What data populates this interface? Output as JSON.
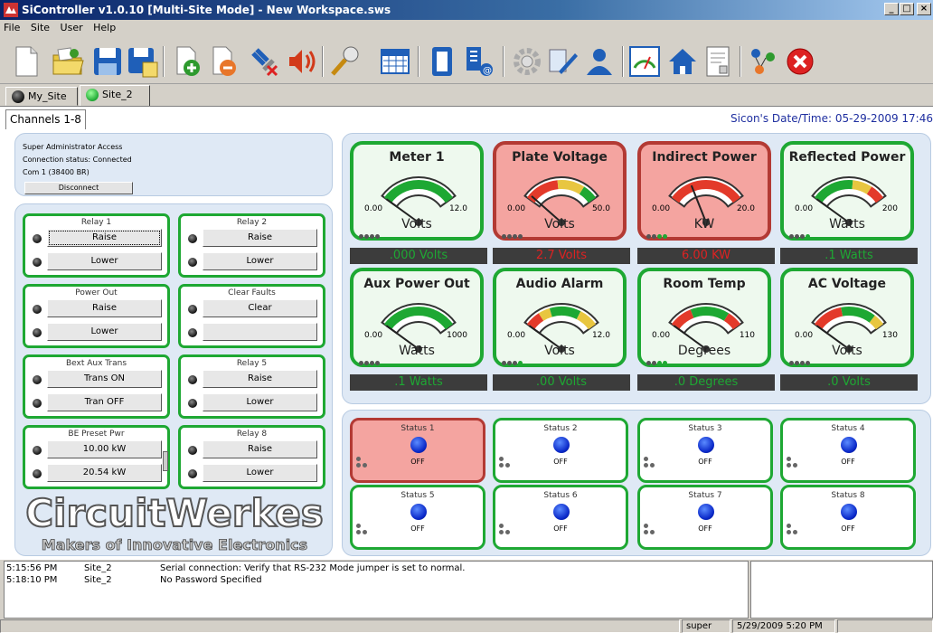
{
  "window": {
    "title": "SiController v1.0.10 [Multi-Site Mode] - New Workspace.sws",
    "controls": [
      "_",
      "□",
      "×"
    ]
  },
  "menu": [
    "File",
    "Site",
    "User",
    "Help"
  ],
  "toolbar_icons": [
    "new-file-icon",
    "open-folder-icon",
    "save-icon",
    "save-as-icon",
    "add-site-icon",
    "remove-site-icon",
    "disconnect-icon",
    "audio-icon",
    "microphone-icon",
    "calendar-icon",
    "panel-icon",
    "network-icon",
    "settings-icon",
    "edit-icon",
    "user-icon",
    "meter-icon",
    "home-icon",
    "report-icon",
    "users-network-icon",
    "exit-icon"
  ],
  "site_tabs": [
    {
      "label": "My_Site",
      "status": "dark"
    },
    {
      "label": "Site_2",
      "status": "green"
    }
  ],
  "channel_tab": "Channels 1-8",
  "sicon_datetime": "Sicon's Date/Time: 05-29-2009 17:46",
  "access": {
    "level": "Super Administrator Access",
    "connection": "Connection status: Connected",
    "port": "Com 1 (38400 BR)",
    "disconnect_label": "Disconnect"
  },
  "relays": [
    {
      "title": "Relay 1",
      "buttons": [
        "Raise",
        "Lower"
      ]
    },
    {
      "title": "Relay 2",
      "buttons": [
        "Raise",
        "Lower"
      ]
    },
    {
      "title": "Power Out",
      "buttons": [
        "Raise",
        "Lower"
      ]
    },
    {
      "title": "Clear Faults",
      "buttons": [
        "Clear",
        ""
      ]
    },
    {
      "title": "Bext Aux Trans",
      "buttons": [
        "Trans ON",
        "Tran OFF"
      ]
    },
    {
      "title": "Relay 5",
      "buttons": [
        "Raise",
        "Lower"
      ]
    },
    {
      "title": "BE Preset Pwr",
      "buttons": [
        "10.00 kW",
        "20.54 kW"
      ]
    },
    {
      "title": "Relay 8",
      "buttons": [
        "Raise",
        "Lower"
      ]
    }
  ],
  "brand": {
    "name": "CircuitWerkes",
    "tagline": "Makers of Innovative Electronics"
  },
  "meters": [
    {
      "title": "Meter 1",
      "unit": "Volts",
      "min": "0.00",
      "max": "12.0",
      "reading": ".000 Volts",
      "alarm": false,
      "needle": 0.0,
      "dots": [
        "d",
        "d",
        "d",
        "d"
      ]
    },
    {
      "title": "Plate Voltage",
      "unit": "Volts",
      "min": "0.00",
      "max": "50.0",
      "reading": "2.7 Volts",
      "alarm": true,
      "needle": 0.05,
      "dots": [
        "d",
        "d",
        "d",
        "d"
      ]
    },
    {
      "title": "Indirect Power",
      "unit": "KW",
      "min": "0.00",
      "max": "20.0",
      "reading": "6.00 KW",
      "alarm": true,
      "needle": 0.3,
      "dots": [
        "d",
        "d",
        "g",
        "g"
      ]
    },
    {
      "title": "Reflected Power",
      "unit": "Watts",
      "min": "0.00",
      "max": "200",
      "reading": ".1 Watts",
      "alarm": false,
      "needle": 0.0,
      "dots": [
        "d",
        "d",
        "d",
        "g"
      ]
    },
    {
      "title": "Aux Power Out",
      "unit": "Watts",
      "min": "0.00",
      "max": "1000",
      "reading": ".1 Watts",
      "alarm": false,
      "needle": 0.0,
      "dots": [
        "d",
        "d",
        "d",
        "d"
      ]
    },
    {
      "title": "Audio Alarm",
      "unit": "Volts",
      "min": "0.00",
      "max": "12.0",
      "reading": ".00 Volts",
      "alarm": false,
      "needle": 0.0,
      "dots": [
        "d",
        "d",
        "d",
        "g"
      ]
    },
    {
      "title": "Room Temp",
      "unit": "Degrees",
      "min": "0.00",
      "max": "110",
      "reading": ".0 Degrees",
      "alarm": false,
      "needle": 0.0,
      "dots": [
        "d",
        "d",
        "g",
        "g"
      ]
    },
    {
      "title": "AC Voltage",
      "unit": "Volts",
      "min": "0.00",
      "max": "130",
      "reading": ".0 Volts",
      "alarm": false,
      "needle": 0.0,
      "dots": [
        "d",
        "d",
        "d",
        "d"
      ]
    }
  ],
  "statuses": [
    {
      "title": "Status 1",
      "state": "OFF",
      "alarm": true
    },
    {
      "title": "Status 2",
      "state": "OFF",
      "alarm": false
    },
    {
      "title": "Status 3",
      "state": "OFF",
      "alarm": false
    },
    {
      "title": "Status 4",
      "state": "OFF",
      "alarm": false
    },
    {
      "title": "Status 5",
      "state": "OFF",
      "alarm": false
    },
    {
      "title": "Status 6",
      "state": "OFF",
      "alarm": false
    },
    {
      "title": "Status 7",
      "state": "OFF",
      "alarm": false
    },
    {
      "title": "Status 8",
      "state": "OFF",
      "alarm": false
    }
  ],
  "log": [
    {
      "time": "5:15:56 PM",
      "site": "Site_2",
      "message": "Serial connection: Verify that RS-232 Mode jumper is set to normal."
    },
    {
      "time": "5:18:10 PM",
      "site": "Site_2",
      "message": "No Password Specified"
    }
  ],
  "statusbar": {
    "user": "super",
    "datetime": "5/29/2009  5:20 PM"
  },
  "colors": {
    "green": "#1ea833",
    "alarm_fill": "#f4a4a0",
    "alarm_border": "#b33a34",
    "led_blue": "#0a28c8",
    "title_blue": "#0a246a"
  }
}
